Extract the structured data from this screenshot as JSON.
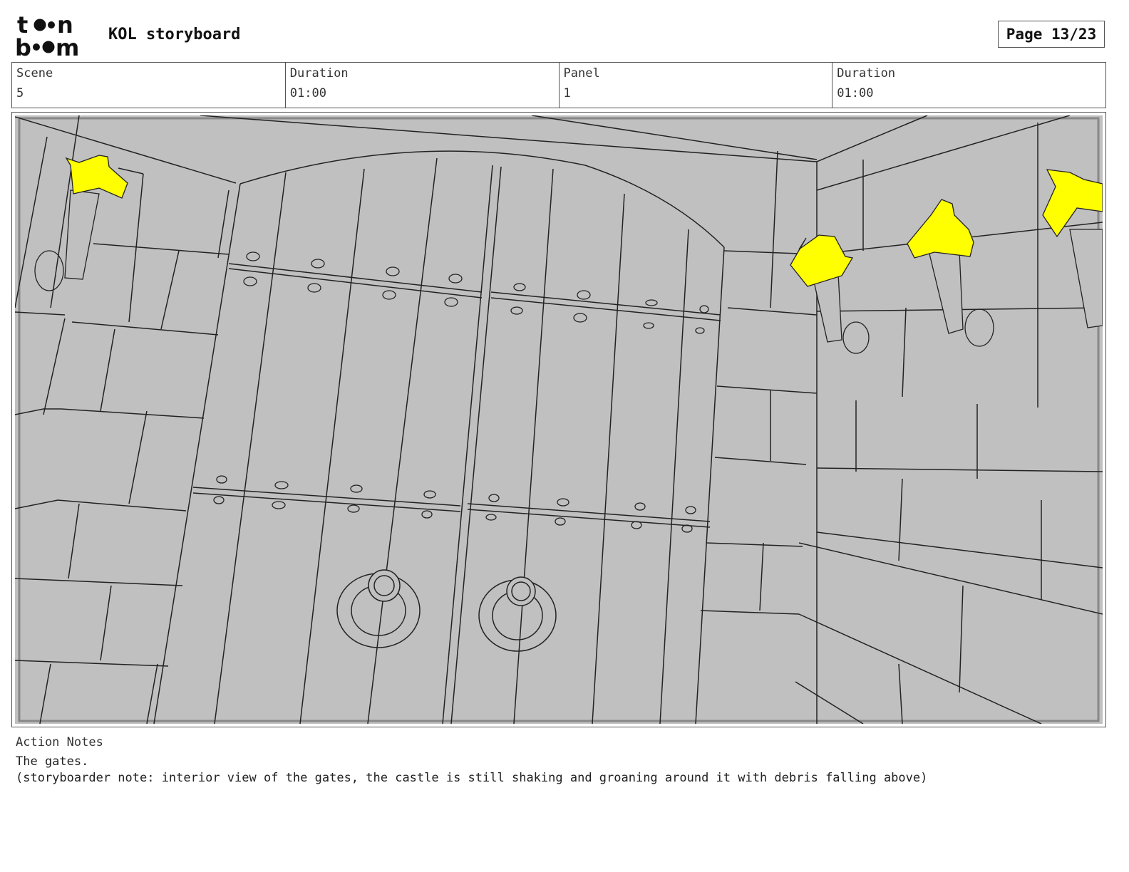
{
  "header": {
    "logo_text": "toonboom",
    "title": "KOL storyboard",
    "page": "Page 13/23"
  },
  "info": [
    {
      "label": "Scene",
      "value": "5"
    },
    {
      "label": "Duration",
      "value": "01:00"
    },
    {
      "label": "Panel",
      "value": "1"
    },
    {
      "label": "Duration",
      "value": "01:00"
    }
  ],
  "panel": {
    "image_subject": "interior castle gates with torches",
    "colors": {
      "background": "#c0c0c0",
      "flame": "#ffff00",
      "line": "#222222"
    }
  },
  "notes": {
    "label": "Action Notes",
    "lines": [
      "The gates.",
      "(storyboarder note: interior view of the gates, the castle is still shaking and groaning around it with debris falling above)"
    ]
  }
}
